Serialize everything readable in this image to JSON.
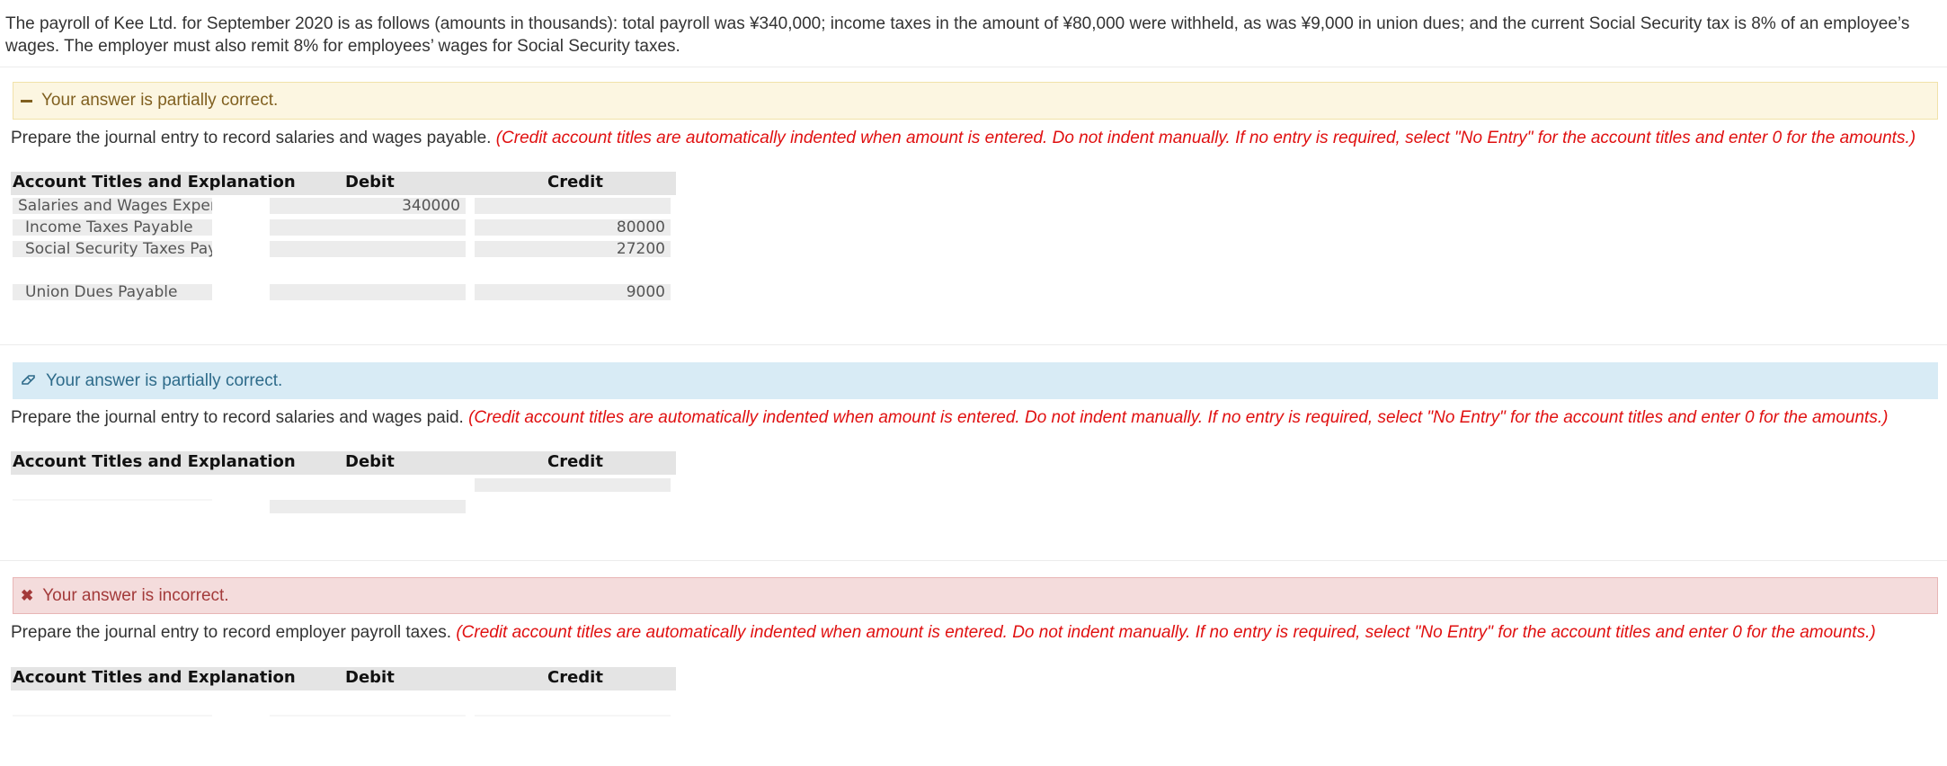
{
  "problem_text": "The payroll of Kee Ltd. for September 2020 is as follows (amounts in thousands): total payroll was ¥340,000; income taxes in the amount of ¥80,000 were withheld, as was ¥9,000 in union dues; and the current Social Security tax is 8% of an employee’s wages. The employer must also remit 8% for employees’ wages for Social Security taxes.",
  "colors": {
    "partial_bg": "#fcf6e1",
    "partial2_bg": "#d8ebf5",
    "incorrect_bg": "#f4dcdc",
    "note_red": "#e01010"
  },
  "sections": [
    {
      "status": "Your answer is partially correct.",
      "status_icon": "dash-icon",
      "instruction": "Prepare the journal entry to record salaries and wages payable.",
      "note": "(Credit account titles are automatically indented when amount is entered. Do not indent manually. If no entry is required, select \"No Entry\" for the account titles and enter 0 for the amounts.)",
      "headers": {
        "account": "Account Titles and Explanation",
        "debit": "Debit",
        "credit": "Credit"
      },
      "rows": [
        {
          "account": "Salaries and Wages Expense",
          "debit": "340000",
          "credit": ""
        },
        {
          "account": "Income Taxes Payable",
          "debit": "",
          "credit": "80000"
        },
        {
          "account": "Social Security Taxes Payable",
          "debit": "",
          "credit": "27200"
        },
        {
          "account": "Union Dues Payable",
          "debit": "",
          "credit": "9000"
        }
      ]
    },
    {
      "status": "Your answer is partially correct.",
      "status_icon": "eraser-icon",
      "instruction": "Prepare the journal entry to record salaries and wages paid.",
      "note": "(Credit account titles are automatically indented when amount is entered. Do not indent manually. If no entry is required, select \"No Entry\" for the account titles and enter 0 for the amounts.)",
      "headers": {
        "account": "Account Titles and Explanation",
        "debit": "Debit",
        "credit": "Credit"
      }
    },
    {
      "status": "Your answer is incorrect.",
      "status_icon": "x-icon",
      "instruction": "Prepare the journal entry to record employer payroll taxes.",
      "note": "(Credit account titles are automatically indented when amount is entered. Do not indent manually. If no entry is required, select \"No Entry\" for the account titles and enter 0 for the amounts.)",
      "headers": {
        "account": "Account Titles and Explanation",
        "debit": "Debit",
        "credit": "Credit"
      }
    }
  ]
}
